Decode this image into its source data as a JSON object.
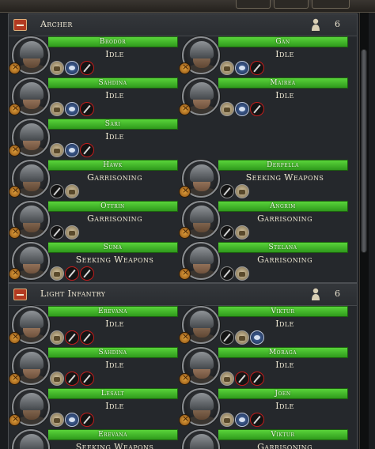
{
  "sections": [
    {
      "title": "Archer",
      "count": "6",
      "units": [
        {
          "name": "Brodor",
          "status": "Idle",
          "icons": [
            "crafting",
            "cavalry",
            "ranged"
          ]
        },
        {
          "name": "Gan",
          "status": "Idle",
          "icons": [
            "crafting",
            "cavalry",
            "ranged"
          ]
        },
        {
          "name": "Sahdina",
          "status": "Idle",
          "icons": [
            "crafting",
            "cavalry",
            "ranged"
          ]
        },
        {
          "name": "Mairea",
          "status": "Idle",
          "icons": [
            "crafting",
            "cavalry",
            "ranged"
          ]
        },
        {
          "name": "Sari",
          "status": "Idle",
          "icons": [
            "crafting",
            "cavalry",
            "ranged"
          ]
        },
        {
          "name": "Hawk",
          "status": "Garrisoning",
          "icons": [
            "melee",
            "crafting"
          ]
        },
        {
          "name": "Derpella",
          "status": "Seeking Weapons",
          "icons": [
            "melee",
            "crafting"
          ]
        },
        {
          "name": "Ottrin",
          "status": "Garrisoning",
          "icons": [
            "melee",
            "crafting"
          ]
        },
        {
          "name": "Angrim",
          "status": "Garrisoning",
          "icons": [
            "melee",
            "crafting"
          ]
        },
        {
          "name": "Suma",
          "status": "Seeking Weapons",
          "icons": [
            "crafting",
            "ranged",
            "ranged"
          ]
        },
        {
          "name": "Stelana",
          "status": "Garrisoning",
          "icons": [
            "melee",
            "crafting"
          ]
        }
      ]
    },
    {
      "title": "Light Infantry",
      "count": "6",
      "units": [
        {
          "name": "Erevana",
          "status": "Idle",
          "icons": [
            "crafting",
            "ranged",
            "ranged"
          ]
        },
        {
          "name": "Viktur",
          "status": "Idle",
          "icons": [
            "melee",
            "crafting",
            "cavalry"
          ]
        },
        {
          "name": "Sahdina",
          "status": "Idle",
          "icons": [
            "crafting",
            "ranged",
            "ranged"
          ]
        },
        {
          "name": "Moraga",
          "status": "Idle",
          "icons": [
            "crafting",
            "ranged",
            "ranged"
          ]
        },
        {
          "name": "Lesalt",
          "status": "Idle",
          "icons": [
            "crafting",
            "cavalry",
            "ranged"
          ]
        },
        {
          "name": "Joen",
          "status": "Idle",
          "icons": [
            "crafting",
            "cavalry",
            "ranged"
          ]
        },
        {
          "name": "Erevana",
          "status": "Seeking Weapons",
          "icons": []
        },
        {
          "name": "Viktur",
          "status": "Garrisoning",
          "icons": []
        }
      ]
    }
  ],
  "colors": {
    "namebar": "#3fb827",
    "panel_bg": "#25282c",
    "badge": "#e2a13c",
    "collapse_button": "#b23a21"
  }
}
